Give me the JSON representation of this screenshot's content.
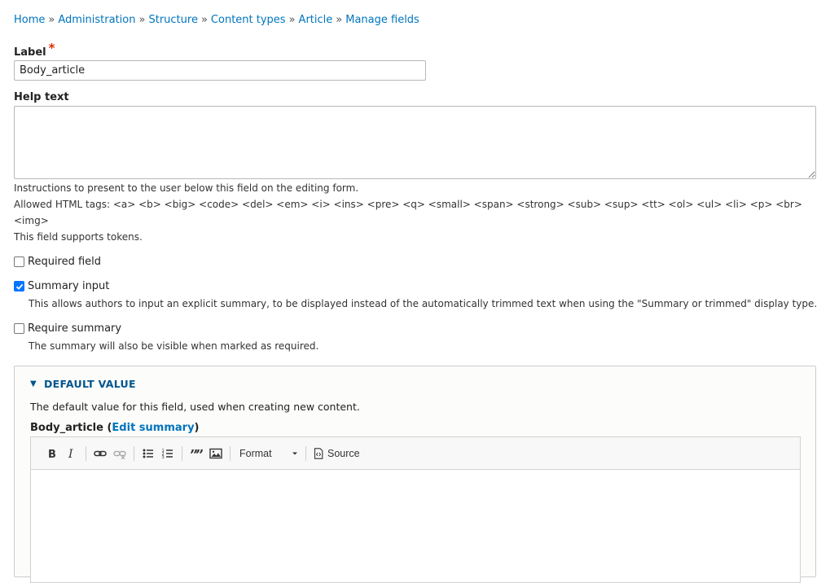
{
  "breadcrumb": [
    "Home",
    "Administration",
    "Structure",
    "Content types",
    "Article",
    "Manage fields"
  ],
  "breadcrumb_separator": "»",
  "label_field": {
    "label": "Label",
    "required_marker": "*",
    "value": "Body_article"
  },
  "help_text": {
    "label": "Help text",
    "value": "",
    "description_line1": "Instructions to present to the user below this field on the editing form.",
    "description_line2": "Allowed HTML tags: <a> <b> <big> <code> <del> <em> <i> <ins> <pre> <q> <small> <span> <strong> <sub> <sup> <tt> <ol> <ul> <li> <p> <br>",
    "description_line3": "<img>",
    "description_line4": "This field supports tokens."
  },
  "checkboxes": {
    "required": {
      "label": "Required field",
      "checked": false
    },
    "summary_input": {
      "label": "Summary input",
      "checked": true,
      "description": "This allows authors to input an explicit summary, to be displayed instead of the automatically trimmed text when using the \"Summary or trimmed\" display type."
    },
    "require_summary": {
      "label": "Require summary",
      "checked": false,
      "description": "The summary will also be visible when marked as required."
    }
  },
  "default_value": {
    "title": "DEFAULT VALUE",
    "description": "The default value for this field, used when creating new content.",
    "editor_label": "Body_article",
    "edit_summary_link": "Edit summary",
    "toolbar": {
      "format_label": "Format",
      "source_label": "Source"
    }
  },
  "colors": {
    "link": "#0074bd",
    "details_title": "#00558e",
    "required": "#e32700",
    "checkbox_checked": "#0075ff"
  }
}
